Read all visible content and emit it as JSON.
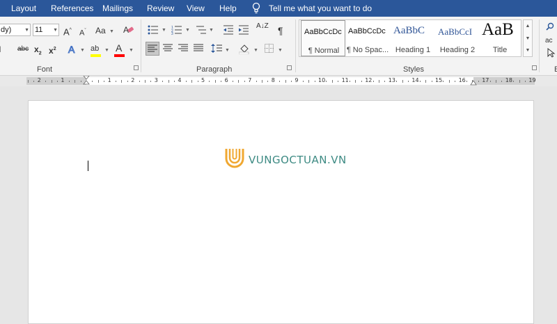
{
  "tabs": [
    "Layout",
    "References",
    "Mailings",
    "Review",
    "View",
    "Help"
  ],
  "tell_me": "Tell me what you want to do",
  "font": {
    "name": "dy)",
    "size": "11"
  },
  "groups": {
    "font": "Font",
    "paragraph": "Paragraph",
    "styles": "Styles"
  },
  "font_buttons": {
    "grow": "A",
    "shrink": "A",
    "case": "Aa",
    "strike": "abc",
    "subscript": "x",
    "superscript": "x",
    "sub_mark": "2",
    "sup_mark": "2",
    "effects": "A",
    "highlight": "ab",
    "font_color": "A"
  },
  "paragraph_buttons": {
    "show_marks": "¶",
    "sort": "A↓Z"
  },
  "styles": [
    {
      "sample": "AaBbCcDc",
      "name": "¶ Normal"
    },
    {
      "sample": "AaBbCcDc",
      "name": "¶ No Spac..."
    },
    {
      "sample": "AaBbC",
      "name": "Heading 1"
    },
    {
      "sample": "AaBbCcI",
      "name": "Heading 2"
    },
    {
      "sample": "AaB",
      "name": "Title"
    }
  ],
  "right_edge": {
    "label": "ac",
    "e_label": "E"
  },
  "ruler_numbers": [
    "2",
    "1",
    "1",
    "2",
    "3",
    "4",
    "5",
    "6",
    "7",
    "8",
    "9",
    "10",
    "11",
    "12",
    "13",
    "14",
    "15",
    "16",
    "17",
    "18",
    "19"
  ],
  "watermark": "VUNGOCTUAN.VN",
  "colors": {
    "titlebar": "#2b579a",
    "ribbon": "#f3f3f3",
    "heading_blue": "#2f5496",
    "logo_orange": "#f0a832",
    "logo_teal": "#3d8a83",
    "highlight_yellow": "#ffff00",
    "font_red": "#ff0000"
  }
}
